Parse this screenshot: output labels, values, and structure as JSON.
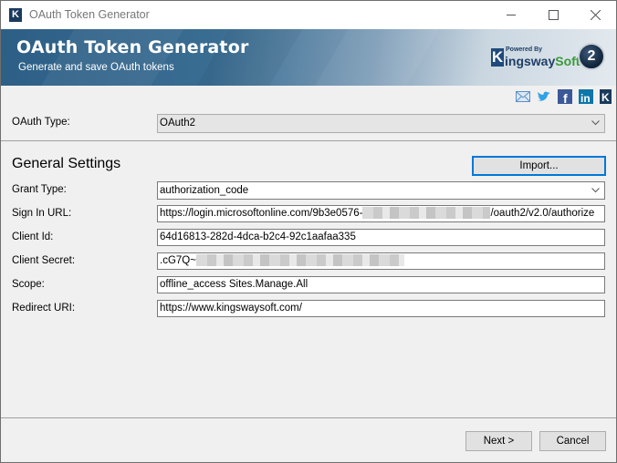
{
  "window": {
    "title": "OAuth Token Generator",
    "app_icon": "K",
    "controls": [
      "minimize-icon",
      "maximize-icon",
      "close-icon"
    ]
  },
  "banner": {
    "title": "OAuth Token Generator",
    "subtitle": "Generate and save OAuth tokens",
    "logo": {
      "k": "K",
      "powered_by": "Powered By",
      "brand_part1": "ingsway",
      "brand_part2": "Soft"
    },
    "badge": "2"
  },
  "social_icons": [
    "email-icon",
    "twitter-icon",
    "facebook-icon",
    "linkedin-icon",
    "kingswaysoft-icon"
  ],
  "oauth_type": {
    "label": "OAuth Type:",
    "value": "OAuth2"
  },
  "general_settings": {
    "title": "General Settings",
    "import_label": "Import...",
    "fields": {
      "grant_type": {
        "label": "Grant Type:",
        "value": "authorization_code"
      },
      "sign_in_url": {
        "label": "Sign In URL:",
        "value_prefix": "https://login.microsoftonline.com/9b3e0576-",
        "value_suffix": "/oauth2/v2.0/authorize"
      },
      "client_id": {
        "label": "Client Id:",
        "value": "64d16813-282d-4dca-b2c4-92c1aafaa335"
      },
      "client_secret": {
        "label": "Client Secret:",
        "value_prefix": ".cG7Q~"
      },
      "scope": {
        "label": "Scope:",
        "value": "offline_access Sites.Manage.All"
      },
      "redirect_uri": {
        "label": "Redirect URI:",
        "value": "https://www.kingswaysoft.com/"
      }
    }
  },
  "footer": {
    "next_label": "Next >",
    "cancel_label": "Cancel"
  }
}
